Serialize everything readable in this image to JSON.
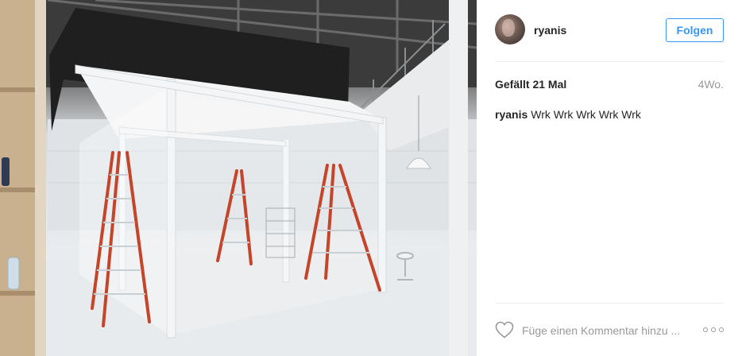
{
  "post": {
    "image": {
      "description_icon": "photo-image",
      "colors": {
        "floor": "#e6e9eb",
        "ladder": "#c4452a",
        "frame": "#f2f4f5",
        "ceiling": "#3a3a3a"
      }
    }
  },
  "header": {
    "username": "ryanis",
    "follow_label": "Folgen"
  },
  "stats": {
    "likes_prefix": "Gefällt ",
    "likes_count": "21 Mal",
    "age": "4Wo."
  },
  "caption": {
    "author": "ryanis",
    "text": "Wrk Wrk Wrk Wrk Wrk"
  },
  "comment": {
    "placeholder": "Füge einen Kommentar hinzu ...",
    "like_icon": "heart-icon",
    "more_icon": "more-options-icon"
  },
  "colors": {
    "accent": "#3897f0",
    "muted": "#999999",
    "divider": "#efefef"
  }
}
